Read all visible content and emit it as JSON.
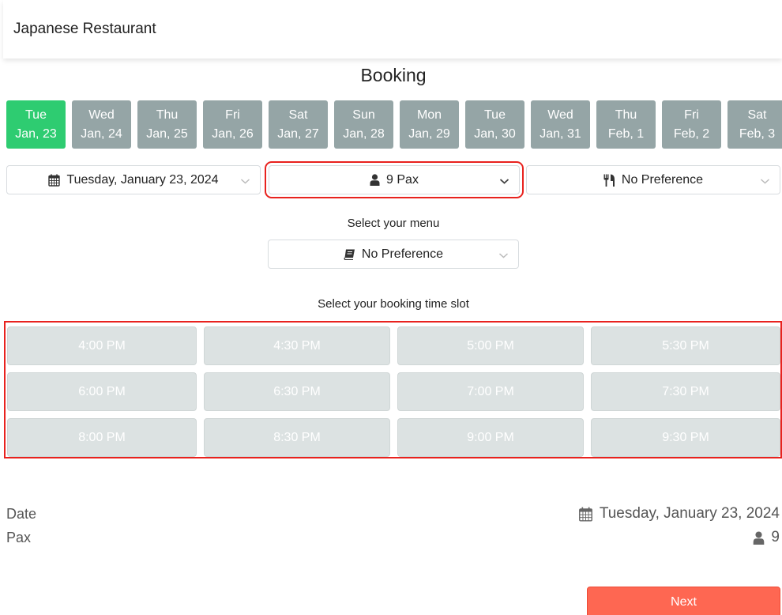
{
  "navbar": {
    "brand": "Japanese Restaurant"
  },
  "page": {
    "title": "Booking"
  },
  "dates": [
    {
      "day": "Tue",
      "date": "Jan, 23",
      "selected": true
    },
    {
      "day": "Wed",
      "date": "Jan, 24",
      "selected": false
    },
    {
      "day": "Thu",
      "date": "Jan, 25",
      "selected": false
    },
    {
      "day": "Fri",
      "date": "Jan, 26",
      "selected": false
    },
    {
      "day": "Sat",
      "date": "Jan, 27",
      "selected": false
    },
    {
      "day": "Sun",
      "date": "Jan, 28",
      "selected": false
    },
    {
      "day": "Mon",
      "date": "Jan, 29",
      "selected": false
    },
    {
      "day": "Tue",
      "date": "Jan, 30",
      "selected": false
    },
    {
      "day": "Wed",
      "date": "Jan, 31",
      "selected": false
    },
    {
      "day": "Thu",
      "date": "Feb, 1",
      "selected": false
    },
    {
      "day": "Fri",
      "date": "Feb, 2",
      "selected": false
    },
    {
      "day": "Sat",
      "date": "Feb, 3",
      "selected": false
    }
  ],
  "selects": {
    "date": {
      "value": "Tuesday, January 23, 2024",
      "icon": "calendar-icon"
    },
    "pax": {
      "value": "9 Pax",
      "icon": "user-icon"
    },
    "preference": {
      "value": "No Preference",
      "icon": "utensils-icon"
    }
  },
  "menu": {
    "label": "Select your menu",
    "value": "No Preference",
    "icon": "book-icon"
  },
  "timeslots": {
    "label": "Select your booking time slot",
    "slots": [
      "4:00 PM",
      "4:30 PM",
      "5:00 PM",
      "5:30 PM",
      "6:00 PM",
      "6:30 PM",
      "7:00 PM",
      "7:30 PM",
      "8:00 PM",
      "8:30 PM",
      "9:00 PM",
      "9:30 PM"
    ],
    "disabled": true
  },
  "summary": {
    "date_label": "Date",
    "date_value": "Tuesday, January 23, 2024",
    "pax_label": "Pax",
    "pax_value": "9"
  },
  "actions": {
    "next": "Next"
  },
  "colors": {
    "selected_date": "#2ecc71",
    "date_tile": "#95a5a6",
    "slot_disabled": "#dce2e2",
    "next_button": "#fe6752",
    "highlight": "#e8221e"
  }
}
